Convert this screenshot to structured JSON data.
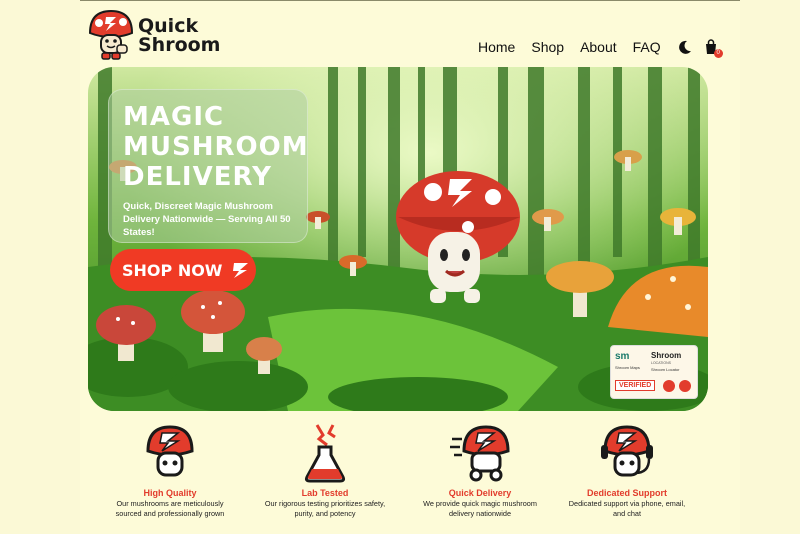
{
  "brand": {
    "name_line1": "Quick",
    "name_line2": "Shroom"
  },
  "nav": {
    "items": [
      "Home",
      "Shop",
      "About",
      "FAQ"
    ],
    "theme_icon": "moon-icon",
    "cart_icon": "shopping-bag-icon",
    "cart_count": "0"
  },
  "hero": {
    "title": "MAGIC MUSHROOM DELIVERY",
    "subtitle": "Quick, Discreet Magic Mushroom Delivery Nationwide — Serving All 50 States!",
    "cta_label": "SHOP NOW",
    "cta_icon": "lightning-bolt-icon",
    "badge": {
      "sm_logo": "sm",
      "sm_caption": "Shroom Maps",
      "shroom_logo": "Shroom",
      "shroom_tagline": "LOCATIONS",
      "shroom_caption": "Shroom Locator",
      "verified_label": "VERIFIED"
    }
  },
  "features": [
    {
      "icon": "mushroom-shield-icon",
      "title": "High Quality",
      "description": "Our mushrooms are meticulously sourced and professionally grown"
    },
    {
      "icon": "lab-flask-icon",
      "title": "Lab Tested",
      "description": "Our rigorous testing prioritizes safety, purity, and potency"
    },
    {
      "icon": "fast-delivery-mushroom-icon",
      "title": "Quick Delivery",
      "description": "We provide quick magic mushroom delivery nationwide"
    },
    {
      "icon": "headset-support-icon",
      "title": "Dedicated Support",
      "description": "Dedicated support via phone, email, and chat"
    }
  ],
  "colors": {
    "accent": "#e23c2c",
    "background": "#fdfbd8",
    "forest": "#2f7d2a"
  }
}
